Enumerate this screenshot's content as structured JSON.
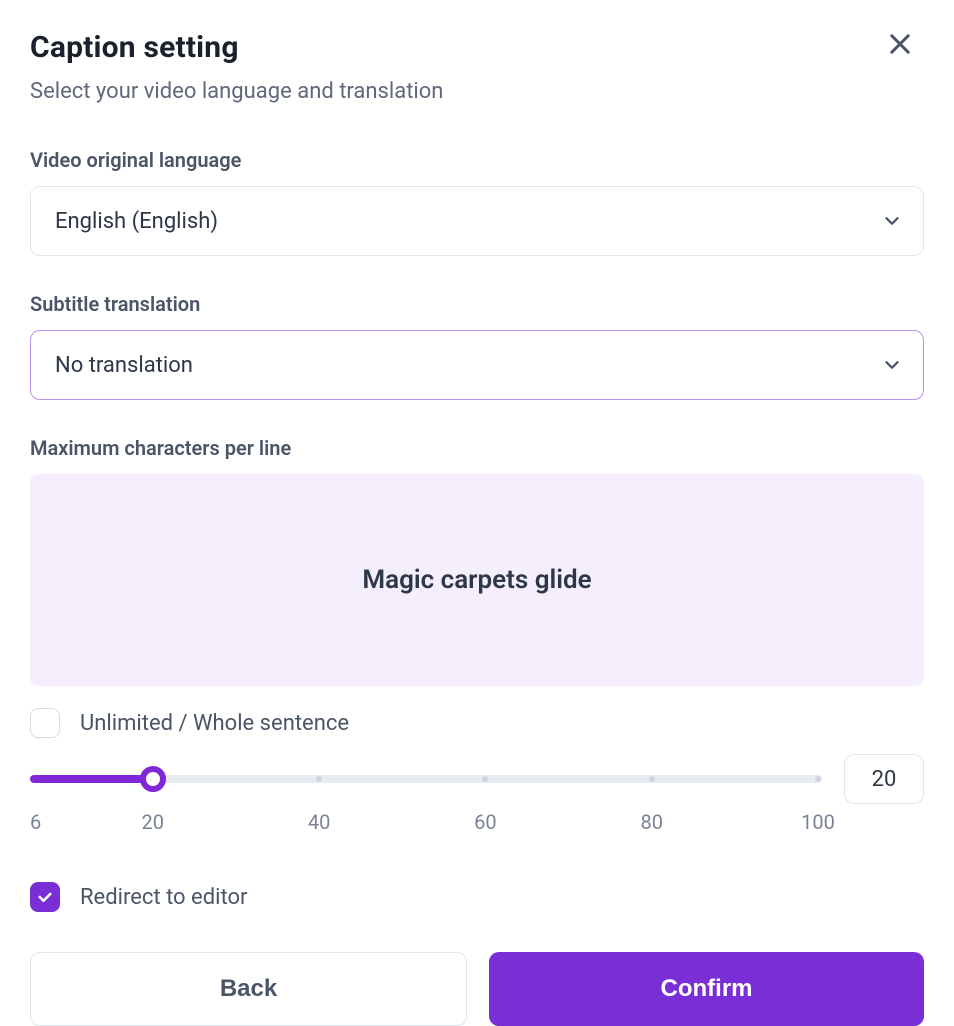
{
  "header": {
    "title": "Caption setting",
    "subtitle": "Select your video language and translation"
  },
  "fields": {
    "original_language": {
      "label": "Video original language",
      "value": "English (English)"
    },
    "subtitle_translation": {
      "label": "Subtitle translation",
      "value": "No translation"
    },
    "max_chars": {
      "label": "Maximum characters per line",
      "preview_text": "Magic carpets glide",
      "unlimited_label": "Unlimited / Whole sentence",
      "unlimited_checked": false,
      "value": "20",
      "min": 6,
      "max": 100,
      "ticks": [
        "6",
        "20",
        "40",
        "60",
        "80",
        "100"
      ]
    },
    "redirect": {
      "label": "Redirect to editor",
      "checked": true
    }
  },
  "buttons": {
    "back": "Back",
    "confirm": "Confirm"
  }
}
